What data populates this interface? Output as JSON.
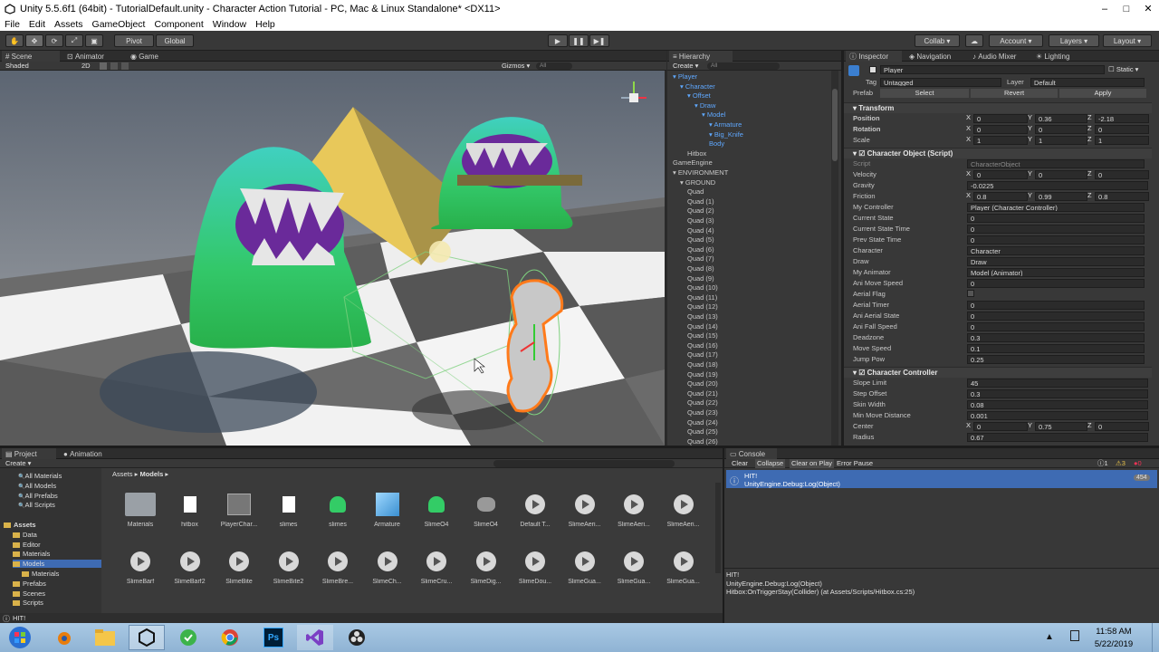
{
  "window": {
    "title": "Unity 5.5.6f1 (64bit) - TutorialDefault.unity - Character Action Tutorial - PC, Mac & Linux Standalone* <DX11>"
  },
  "menu": [
    "File",
    "Edit",
    "Assets",
    "GameObject",
    "Component",
    "Window",
    "Help"
  ],
  "toolbar": {
    "pivot": "Pivot",
    "global": "Global",
    "collab": "Collab ▾",
    "account": "Account",
    "layers": "Layers",
    "layout": "Layout"
  },
  "scene": {
    "tabs": {
      "scene": "Scene",
      "animator": "Animator",
      "game": "Game"
    },
    "shaded": "Shaded",
    "mode2d": "2D",
    "gizmos": "Gizmos ▾",
    "search": "All"
  },
  "hierarchy": {
    "tab": "Hierarchy",
    "create": "Create ▾",
    "search": "All",
    "items": [
      {
        "label": "Player",
        "depth": 0,
        "blue": true
      },
      {
        "label": "Character",
        "depth": 1,
        "blue": true
      },
      {
        "label": "Offset",
        "depth": 2,
        "blue": true
      },
      {
        "label": "Draw",
        "depth": 3,
        "blue": true
      },
      {
        "label": "Model",
        "depth": 4,
        "blue": true
      },
      {
        "label": "Armature",
        "depth": 5,
        "blue": true
      },
      {
        "label": "Big_Knife",
        "depth": 5,
        "blue": true
      },
      {
        "label": "Body",
        "depth": 5,
        "blue": true
      },
      {
        "label": "Hitbox",
        "depth": 2,
        "blue": false
      },
      {
        "label": "GameEngine",
        "depth": 0,
        "blue": false
      },
      {
        "label": "ENVIRONMENT",
        "depth": 0,
        "blue": false
      },
      {
        "label": "GROUND",
        "depth": 1,
        "blue": false
      },
      {
        "label": "Quad",
        "depth": 2,
        "blue": false
      },
      {
        "label": "Quad (1)",
        "depth": 2,
        "blue": false
      },
      {
        "label": "Quad (2)",
        "depth": 2,
        "blue": false
      },
      {
        "label": "Quad (3)",
        "depth": 2,
        "blue": false
      },
      {
        "label": "Quad (4)",
        "depth": 2,
        "blue": false
      },
      {
        "label": "Quad (5)",
        "depth": 2,
        "blue": false
      },
      {
        "label": "Quad (6)",
        "depth": 2,
        "blue": false
      },
      {
        "label": "Quad (7)",
        "depth": 2,
        "blue": false
      },
      {
        "label": "Quad (8)",
        "depth": 2,
        "blue": false
      },
      {
        "label": "Quad (9)",
        "depth": 2,
        "blue": false
      },
      {
        "label": "Quad (10)",
        "depth": 2,
        "blue": false
      },
      {
        "label": "Quad (11)",
        "depth": 2,
        "blue": false
      },
      {
        "label": "Quad (12)",
        "depth": 2,
        "blue": false
      },
      {
        "label": "Quad (13)",
        "depth": 2,
        "blue": false
      },
      {
        "label": "Quad (14)",
        "depth": 2,
        "blue": false
      },
      {
        "label": "Quad (15)",
        "depth": 2,
        "blue": false
      },
      {
        "label": "Quad (16)",
        "depth": 2,
        "blue": false
      },
      {
        "label": "Quad (17)",
        "depth": 2,
        "blue": false
      },
      {
        "label": "Quad (18)",
        "depth": 2,
        "blue": false
      },
      {
        "label": "Quad (19)",
        "depth": 2,
        "blue": false
      },
      {
        "label": "Quad (20)",
        "depth": 2,
        "blue": false
      },
      {
        "label": "Quad (21)",
        "depth": 2,
        "blue": false
      },
      {
        "label": "Quad (22)",
        "depth": 2,
        "blue": false
      },
      {
        "label": "Quad (23)",
        "depth": 2,
        "blue": false
      },
      {
        "label": "Quad (24)",
        "depth": 2,
        "blue": false
      },
      {
        "label": "Quad (25)",
        "depth": 2,
        "blue": false
      },
      {
        "label": "Quad (26)",
        "depth": 2,
        "blue": false
      }
    ]
  },
  "inspector": {
    "tabs": {
      "inspector": "Inspector",
      "navigation": "Navigation",
      "audio_mixer": "Audio Mixer",
      "lighting": "Lighting"
    },
    "object_name": "Player",
    "static": "Static",
    "tag_label": "Tag",
    "tag_value": "Untagged",
    "layer_label": "Layer",
    "layer_value": "Default",
    "prefab_label": "Prefab",
    "prefab_select": "Select",
    "prefab_revert": "Revert",
    "prefab_apply": "Apply",
    "transform": {
      "header": "Transform",
      "position": {
        "label": "Position",
        "x": "0",
        "y": "0.36",
        "z": "-2.18"
      },
      "rotation": {
        "label": "Rotation",
        "x": "0",
        "y": "0",
        "z": "0"
      },
      "scale": {
        "label": "Scale",
        "x": "1",
        "y": "1",
        "z": "1"
      }
    },
    "character_object": {
      "header": "Character Object (Script)",
      "script_label": "Script",
      "script_value": "CharacterObject",
      "velocity": {
        "label": "Velocity",
        "x": "0",
        "y": "0",
        "z": "0"
      },
      "gravity": {
        "label": "Gravity",
        "value": "-0.0225"
      },
      "friction": {
        "label": "Friction",
        "x": "0.8",
        "y": "0.99",
        "z": "0.8"
      },
      "fields": [
        {
          "label": "My Controller",
          "value": "Player (Character Controller)"
        },
        {
          "label": "Current State",
          "value": "0"
        },
        {
          "label": "Current State Time",
          "value": "0"
        },
        {
          "label": "Prev State Time",
          "value": "0"
        },
        {
          "label": "Character",
          "value": "Character"
        },
        {
          "label": "Draw",
          "value": "Draw"
        },
        {
          "label": "My Animator",
          "value": "Model (Animator)"
        },
        {
          "label": "Ani Move Speed",
          "value": "0"
        },
        {
          "label": "Aerial Flag",
          "value": ""
        },
        {
          "label": "Aerial Timer",
          "value": "0"
        },
        {
          "label": "Ani Aerial State",
          "value": "0"
        },
        {
          "label": "Ani Fall Speed",
          "value": "0"
        },
        {
          "label": "Deadzone",
          "value": "0.3"
        },
        {
          "label": "Move Speed",
          "value": "0.1"
        },
        {
          "label": "Jump Pow",
          "value": "0.25"
        }
      ]
    },
    "character_controller": {
      "header": "Character Controller",
      "fields": [
        {
          "label": "Slope Limit",
          "value": "45"
        },
        {
          "label": "Step Offset",
          "value": "0.3"
        },
        {
          "label": "Skin Width",
          "value": "0.08"
        },
        {
          "label": "Min Move Distance",
          "value": "0.001"
        }
      ],
      "center": {
        "label": "Center",
        "x": "0",
        "y": "0.75",
        "z": "0"
      },
      "radius": {
        "label": "Radius",
        "value": "0.67"
      }
    }
  },
  "project": {
    "tabs": {
      "project": "Project",
      "animation": "Animation"
    },
    "create": "Create ▾",
    "favorites": [
      "All Materials",
      "All Models",
      "All Prefabs",
      "All Scripts"
    ],
    "tree": [
      {
        "label": "Assets",
        "depth": 0
      },
      {
        "label": "Data",
        "depth": 1
      },
      {
        "label": "Editor",
        "depth": 1
      },
      {
        "label": "Materials",
        "depth": 1
      },
      {
        "label": "Models",
        "depth": 1
      },
      {
        "label": "Materials",
        "depth": 2
      },
      {
        "label": "Prefabs",
        "depth": 1
      },
      {
        "label": "Scenes",
        "depth": 1
      },
      {
        "label": "Scripts",
        "depth": 1
      }
    ],
    "breadcrumb": {
      "root": "Assets",
      "sep": "▸",
      "current": "Models",
      "end": "▸"
    },
    "row1": [
      {
        "label": "Materials",
        "kind": "folder"
      },
      {
        "label": "hitbox",
        "kind": "doc"
      },
      {
        "label": "PlayerChar...",
        "kind": "controller"
      },
      {
        "label": "slimes",
        "kind": "doc"
      },
      {
        "label": "slimes",
        "kind": "mesh"
      },
      {
        "label": "Armature",
        "kind": "cube"
      },
      {
        "label": "SlimeO4",
        "kind": "mesh"
      },
      {
        "label": "SlimeO4",
        "kind": "grey"
      },
      {
        "label": "Default T...",
        "kind": "anim"
      },
      {
        "label": "SlimeAeri...",
        "kind": "anim"
      },
      {
        "label": "SlimeAeri...",
        "kind": "anim"
      },
      {
        "label": "SlimeAeri...",
        "kind": "anim"
      }
    ],
    "row2": [
      {
        "label": "SlimeBarf"
      },
      {
        "label": "SlimeBarf2"
      },
      {
        "label": "SlimeBite"
      },
      {
        "label": "SlimeBite2"
      },
      {
        "label": "SlimeBre..."
      },
      {
        "label": "SlimeCh..."
      },
      {
        "label": "SlimeCru..."
      },
      {
        "label": "SlimeDig..."
      },
      {
        "label": "SlimeDou..."
      },
      {
        "label": "SlimeGua..."
      },
      {
        "label": "SlimeGua..."
      },
      {
        "label": "SlimeGua..."
      }
    ]
  },
  "console": {
    "tab": "Console",
    "clear": "Clear",
    "collapse": "Collapse",
    "clear_on_play": "Clear on Play",
    "error_pause": "Error Pause",
    "info_count": "1",
    "warn_count": "3",
    "err_count": "0",
    "entry_line1": "HIT!",
    "entry_line2": "UnityEngine.Debug:Log(Object)",
    "entry_count": "454",
    "detail": [
      "HIT!",
      "UnityEngine.Debug:Log(Object)",
      "Hitbox:OnTriggerStay(Collider) (at Assets/Scripts/Hitbox.cs:25)"
    ]
  },
  "statusbar": {
    "text": "HIT!"
  },
  "taskbar": {
    "apps": [
      "start-orb",
      "blender",
      "file-explorer",
      "unity",
      "green-app",
      "chrome",
      "photoshop",
      "visual-studio",
      "obs"
    ],
    "ps_label": "Ps",
    "time": "11:58 AM",
    "date": "5/22/2019"
  },
  "colors": {
    "accent": "#3e6bb3",
    "prefab_blue": "#5fa8ff",
    "slime_green": "#33cc66",
    "slime_top": "#40d0c0",
    "pyramid": "#e8c85a"
  }
}
